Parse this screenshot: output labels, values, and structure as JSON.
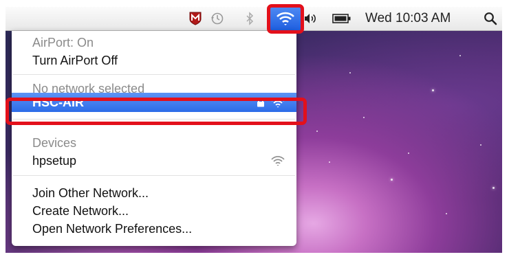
{
  "menubar": {
    "clock": "Wed 10:03 AM",
    "icons": [
      "mcafee-icon",
      "time-machine-icon",
      "bluetooth-icon",
      "wifi-icon",
      "volume-icon",
      "battery-icon",
      "spotlight-search-icon"
    ],
    "active_color": "#2c6ce8"
  },
  "dropdown": {
    "status": "AirPort: On",
    "toggle": "Turn AirPort Off",
    "no_network": "No network selected",
    "selected_network": "HSC-AIR",
    "devices_header": "Devices",
    "device": "hpsetup",
    "join_other": "Join Other Network...",
    "create": "Create Network...",
    "open_prefs": "Open Network Preferences..."
  },
  "highlight_color": "#e3101b"
}
